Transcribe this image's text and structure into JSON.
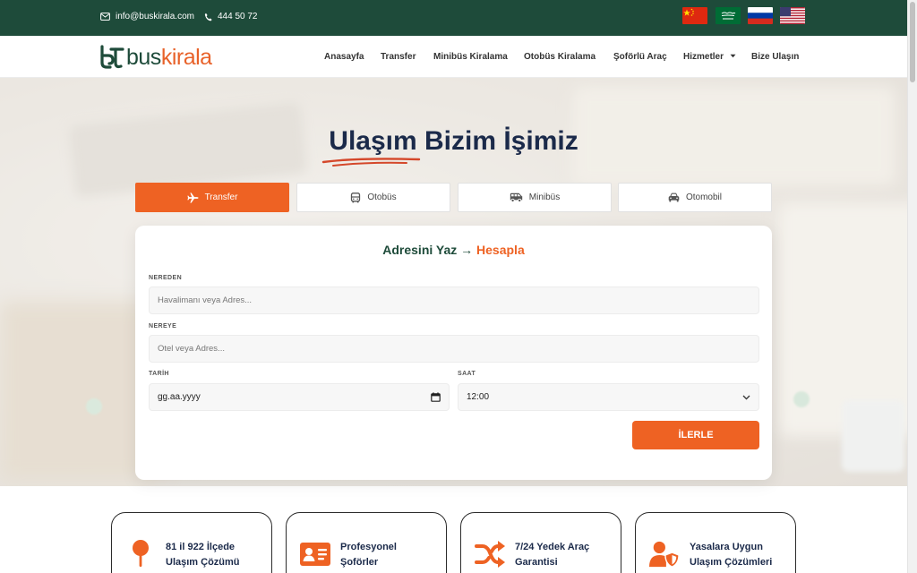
{
  "topbar": {
    "email": "info@buskirala.com",
    "phone": "444 50 72",
    "flags": [
      "china-flag-icon",
      "saudi-arabia-flag-icon",
      "russia-flag-icon",
      "usa-flag-icon"
    ]
  },
  "logo": {
    "part1": "bus",
    "part2": "kirala"
  },
  "nav": {
    "items": [
      "Anasayfa",
      "Transfer",
      "Minibüs Kiralama",
      "Otobüs Kiralama",
      "Şoförlü Araç",
      "Hizmetler",
      "Bize Ulaşın"
    ]
  },
  "hero": {
    "title": "Ulaşım Bizim İşimiz"
  },
  "tabs": [
    {
      "label": "Transfer",
      "icon": "plane-icon",
      "active": true
    },
    {
      "label": "Otobüs",
      "icon": "bus-icon",
      "active": false
    },
    {
      "label": "Minibüs",
      "icon": "van-icon",
      "active": false
    },
    {
      "label": "Otomobil",
      "icon": "car-icon",
      "active": false
    }
  ],
  "form": {
    "title_part1": "Adresini Yaz → ",
    "title_part2": "Hesapla",
    "from_label": "NEREDEN",
    "from_placeholder": "Havalimanı veya Adres...",
    "to_label": "NEREYE",
    "to_placeholder": "Otel veya Adres...",
    "date_label": "TARİH",
    "date_value": "gg.aa.yyyy",
    "time_label": "SAAT",
    "time_value": "12:00",
    "submit_label": "İLERLE"
  },
  "features": [
    {
      "line1": "81 il 922 İlçede",
      "line2": "Ulaşım Çözümü",
      "icon": "map-pin-icon"
    },
    {
      "line1": "Profesyonel",
      "line2": "Şoförler",
      "icon": "id-card-icon"
    },
    {
      "line1": "7/24 Yedek Araç",
      "line2": "Garantisi",
      "icon": "shuffle-icon"
    },
    {
      "line1": "Yasalara Uygun",
      "line2": "Ulaşım Çözümleri",
      "icon": "user-shield-icon"
    }
  ],
  "colors": {
    "topbar": "#1e4b3a",
    "accent": "#ee6223",
    "heading": "#1b2a4a"
  }
}
